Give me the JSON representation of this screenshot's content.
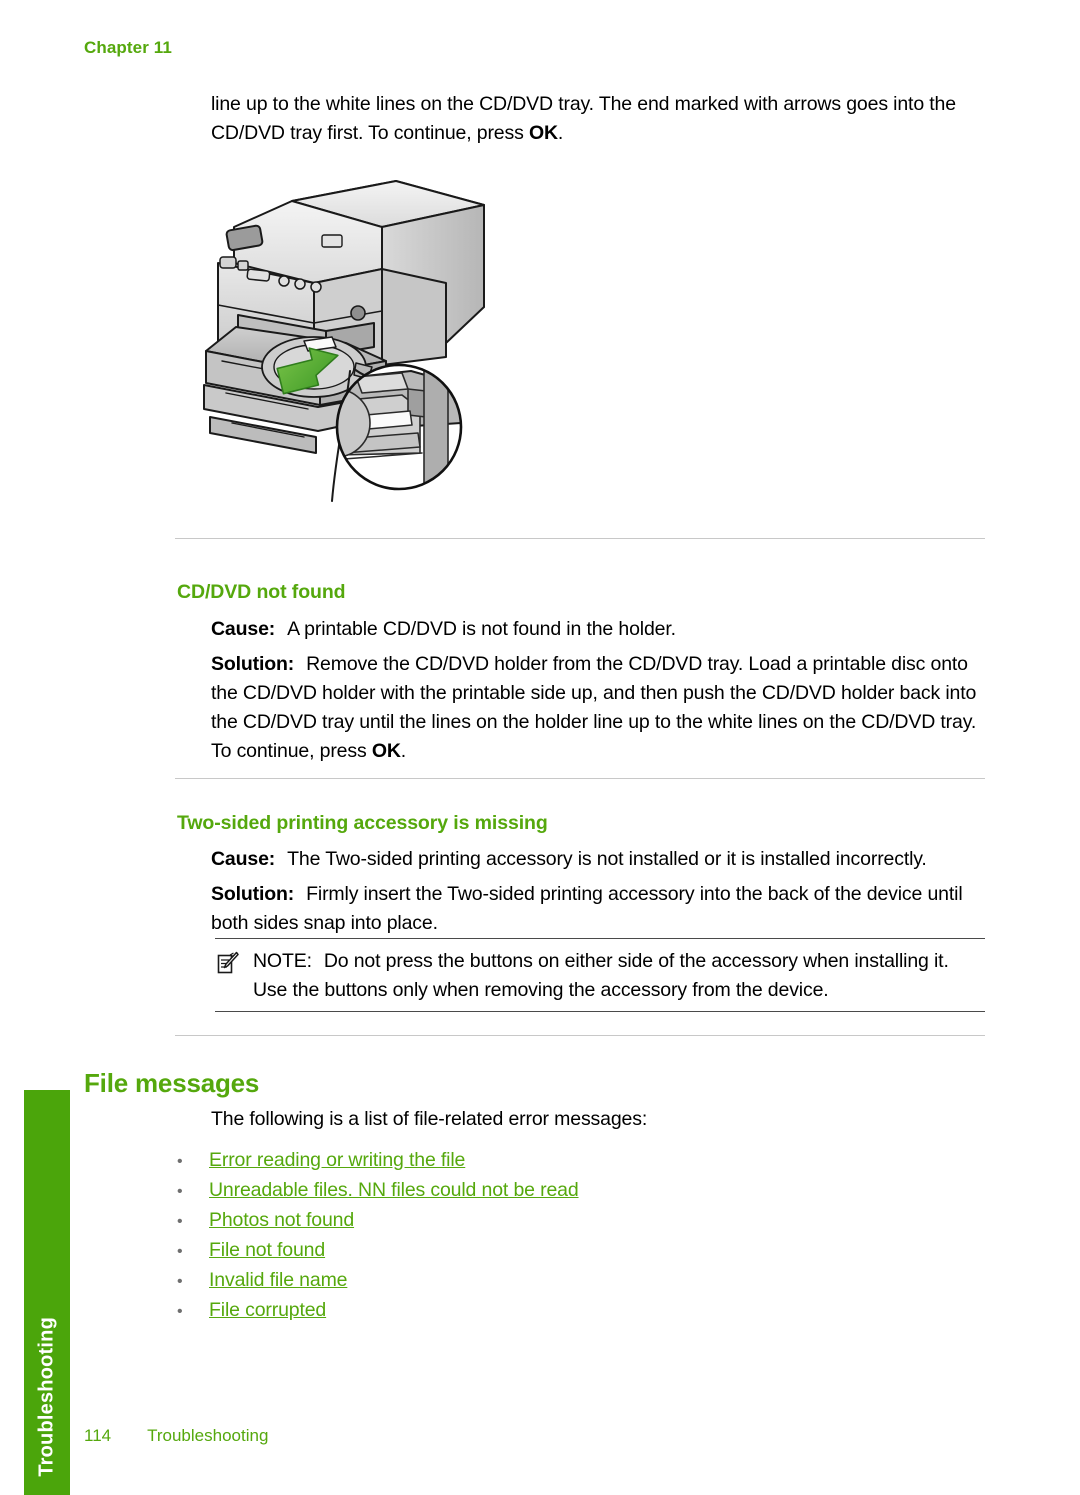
{
  "page": {
    "chapter_label": "Chapter 11",
    "accent_color": "#55a80d",
    "tab_color": "#4ba50b",
    "side_tab_label": "Troubleshooting",
    "footer_page_number": "114",
    "footer_section": "Troubleshooting"
  },
  "intro": {
    "text_before_ok": "line up to the white lines on the CD/DVD tray. The end marked with arrows goes into the CD/DVD tray first. To continue, press ",
    "ok": "OK",
    "text_after_ok": "."
  },
  "illustration": {
    "name": "printer-cd-dvd-tray-illustration",
    "arrow_color": "#4aa832",
    "callout_label": "magnified-tray-detail"
  },
  "sections": [
    {
      "heading": "CD/DVD not found",
      "cause_label": "Cause:",
      "cause_text": "A printable CD/DVD is not found in the holder.",
      "solution_label": "Solution:",
      "solution_text_before_ok": "Remove the CD/DVD holder from the CD/DVD tray. Load a printable disc onto the CD/DVD holder with the printable side up, and then push the CD/DVD holder back into the CD/DVD tray until the lines on the holder line up to the white lines on the CD/DVD tray. To continue, press ",
      "solution_ok": "OK",
      "solution_text_after_ok": "."
    },
    {
      "heading": "Two-sided printing accessory is missing",
      "cause_label": "Cause:",
      "cause_text": "The Two-sided printing accessory is not installed or it is installed incorrectly.",
      "solution_label": "Solution:",
      "solution_text_before_ok": "Firmly insert the Two-sided printing accessory into the back of the device until both sides snap into place.",
      "solution_ok": "",
      "solution_text_after_ok": ""
    }
  ],
  "note": {
    "icon_name": "note-pad-pencil-icon",
    "label": "NOTE:",
    "text": "Do not press the buttons on either side of the accessory when installing it. Use the buttons only when removing the accessory from the device."
  },
  "file_messages": {
    "heading": "File messages",
    "intro": "The following is a list of file-related error messages:",
    "links": [
      "Error reading or writing the file",
      "Unreadable files. NN files could not be read",
      "Photos not found",
      "File not found",
      "Invalid file name",
      "File corrupted"
    ]
  }
}
